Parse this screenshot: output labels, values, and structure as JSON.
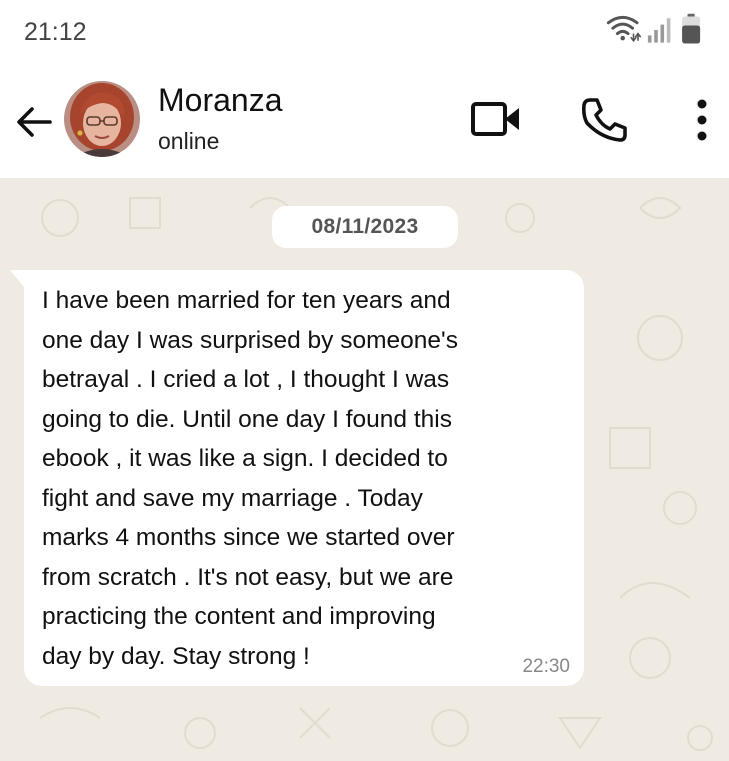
{
  "status_bar": {
    "time": "21:12",
    "icons": [
      "wifi-icon",
      "signal-icon",
      "battery-icon"
    ]
  },
  "header": {
    "contact_name": "Moranza",
    "contact_status": "online",
    "actions": [
      "back-arrow-icon",
      "video-call-icon",
      "phone-icon",
      "more-vert-icon"
    ]
  },
  "chat": {
    "date_chip": "08/11/2023",
    "messages": [
      {
        "direction": "incoming",
        "text": "I have been married  for ten years and\none day I was surprised  by someone's\nbetrayal . I cried a lot , I thought  I was\ngoing to die. Until one day I found this\nebook , it was like a sign. I decided to\nfight and save my marriage . Today\nmarks 4 months  since we started over\nfrom scratch . It's not easy, but we are\npracticing the content and improving\nday by day. Stay strong !",
        "time": "22:30"
      }
    ]
  },
  "colors": {
    "chat_background": "#efeae2",
    "bubble": "#ffffff",
    "header_background": "#ffffff",
    "timestamp": "#888888"
  }
}
